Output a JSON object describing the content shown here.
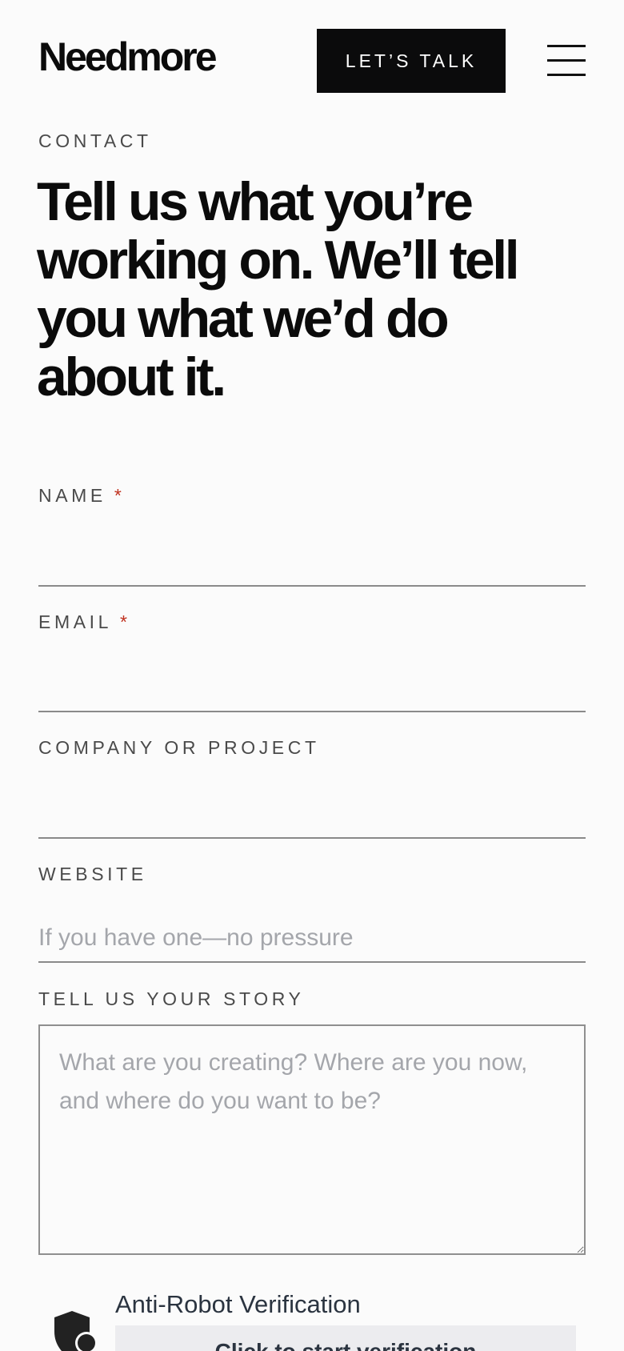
{
  "header": {
    "logo": "Needmore",
    "cta_label": "LET’S TALK"
  },
  "eyebrow": "CONTACT",
  "headline": "Tell us what you’re working on. We’ll tell you what we’d do about it.",
  "form": {
    "name": {
      "label": "NAME",
      "required_mark": "*",
      "value": "",
      "placeholder": ""
    },
    "email": {
      "label": "EMAIL",
      "required_mark": "*",
      "value": "",
      "placeholder": ""
    },
    "company": {
      "label": "COMPANY OR PROJECT",
      "value": "",
      "placeholder": ""
    },
    "website": {
      "label": "WEBSITE",
      "value": "",
      "placeholder": "If you have one—no pressure"
    },
    "story": {
      "label": "TELL US YOUR STORY",
      "value": "",
      "placeholder": "What are you creating? Where are you now, and where do you want to be?"
    }
  },
  "verification": {
    "label": "Anti-Robot Verification",
    "button_label": "Click to start verification",
    "icon": "shield-icon"
  },
  "colors": {
    "background": "#fbfbfb",
    "cta_background": "#0b0b0c",
    "required": "#c0311f",
    "placeholder": "#a4a6ab"
  }
}
